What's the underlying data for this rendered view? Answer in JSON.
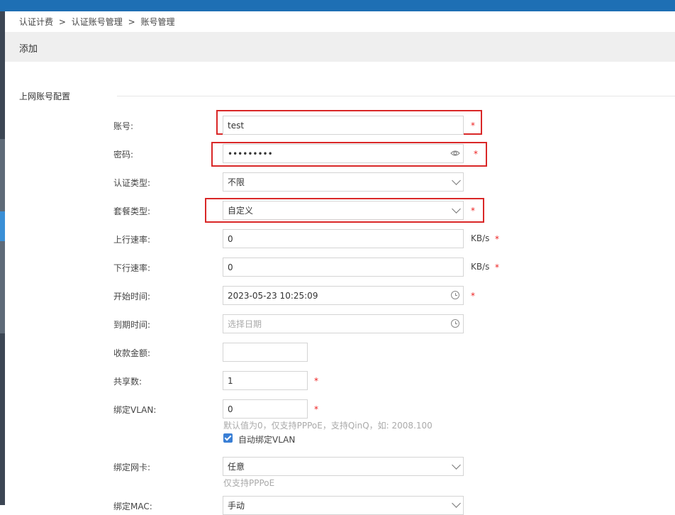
{
  "breadcrumb": [
    "认证计费",
    "认证账号管理",
    "账号管理"
  ],
  "breadcrumb_sep": ">",
  "header": {
    "title": "添加"
  },
  "section": {
    "title": "上网账号配置"
  },
  "colors": {
    "topbar": "#1e6fb4",
    "required": "#e22222",
    "highlight": "#d92727",
    "checkbox": "#3a7fd5"
  },
  "form": {
    "account": {
      "label": "账号:",
      "value": "test"
    },
    "password": {
      "label": "密码:",
      "value": "•••••••••"
    },
    "auth_type": {
      "label": "认证类型:",
      "value": "不限"
    },
    "package_type": {
      "label": "套餐类型:",
      "value": "自定义"
    },
    "up_rate": {
      "label": "上行速率:",
      "value": "0",
      "unit": "KB/s"
    },
    "down_rate": {
      "label": "下行速率:",
      "value": "0",
      "unit": "KB/s"
    },
    "start_time": {
      "label": "开始时间:",
      "value": "2023-05-23 10:25:09"
    },
    "end_time": {
      "label": "到期时间:",
      "placeholder": "选择日期"
    },
    "amount": {
      "label": "收款金额:",
      "value": ""
    },
    "share": {
      "label": "共享数:",
      "value": "1"
    },
    "vlan": {
      "label": "绑定VLAN:",
      "value": "0",
      "hint": "默认值为0，仅支持PPPoE，支持QinQ，如: 2008.100",
      "auto_bind_label": "自动绑定VLAN",
      "auto_bind_checked": true
    },
    "nic": {
      "label": "绑定网卡:",
      "value": "任意",
      "hint": "仅支持PPPoE"
    },
    "mac": {
      "label": "绑定MAC:",
      "value": "手动"
    }
  },
  "required_mark": "*"
}
